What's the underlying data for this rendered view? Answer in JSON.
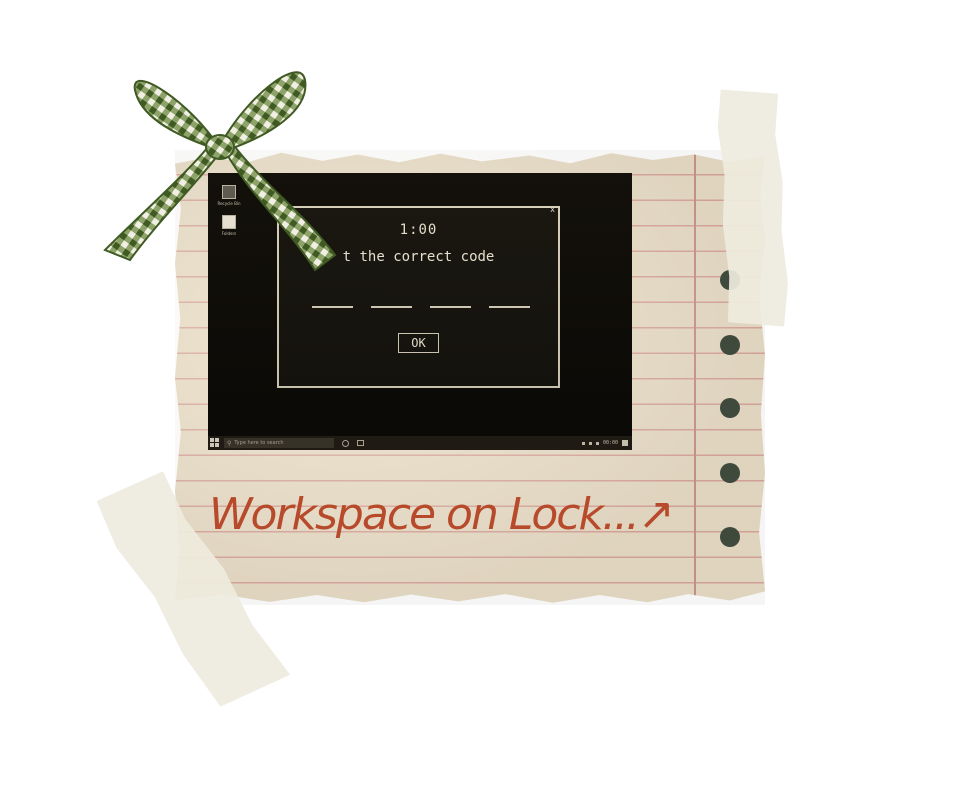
{
  "desktop": {
    "icons": [
      {
        "label": "Recycle Bin",
        "icon": "recycle-bin-icon"
      },
      {
        "label": "Folders",
        "icon": "file-icon"
      }
    ]
  },
  "dialog": {
    "close_label": "x",
    "timer": "1:00",
    "prompt": "t the correct code",
    "code_slots": 4,
    "ok_label": "OK"
  },
  "taskbar": {
    "search_placeholder": "Type here to search",
    "clock": "00:00"
  },
  "caption": {
    "text": "Workspace on Lock...↗"
  },
  "colors": {
    "paper": "#e8dcc6",
    "screen_bg": "#0c0a06",
    "text_light": "#ede6d4",
    "caption": "#b84a2c",
    "bow_green": "#4f6b2e"
  }
}
